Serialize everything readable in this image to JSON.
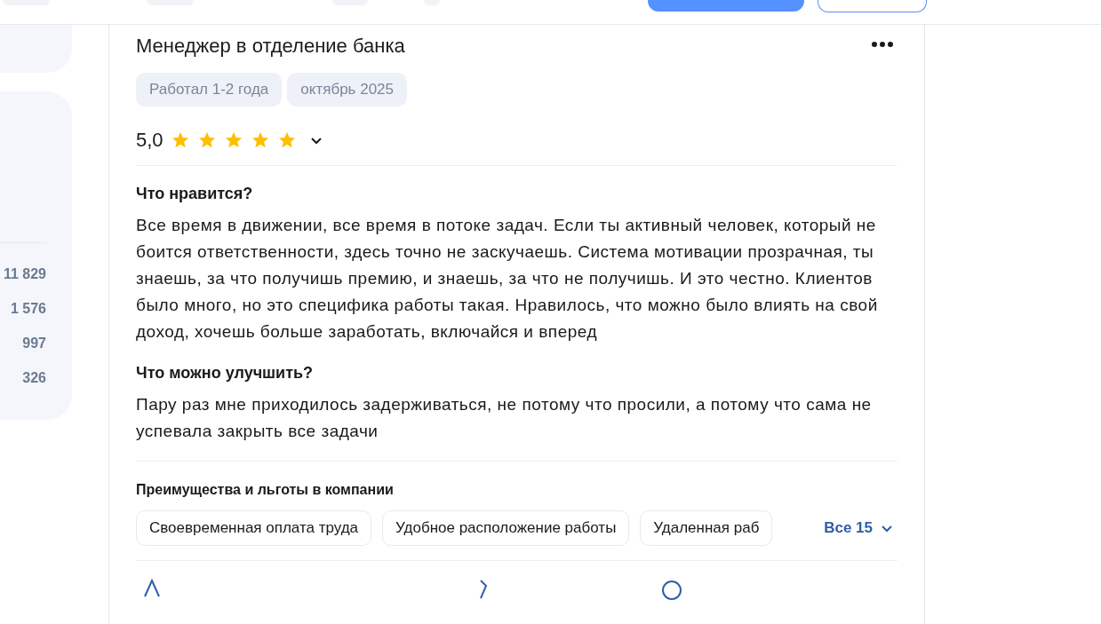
{
  "sidebar": {
    "counts": [
      "11 829",
      "1 576",
      "997",
      "326"
    ]
  },
  "review": {
    "title": "Менеджер в отделение банка",
    "tags": [
      "Работал 1-2 года",
      "октябрь 2025"
    ],
    "rating": "5,0",
    "stars": 5,
    "expanded": false,
    "sections": [
      {
        "heading": "Что нравится?",
        "text": "Все время в движении, все время в потоке задач. Если ты активный человек, который не боится ответственности, здесь точно не заскучаешь. Система мотивации прозрачная, ты знаешь, за что получишь премию, и знаешь, за что не получишь. И это честно. Клиентов было много, но это специфика работы такая. Нравилось, что можно было влиять на свой доход, хочешь больше заработать, включайся и вперед"
      },
      {
        "heading": "Что можно улучшить?",
        "text": "Пару раз мне приходилось задерживаться, не потому что просили, а потому что сама не успевала закрыть все задачи"
      }
    ],
    "benefits": {
      "heading": "Преимущества и льготы в компании",
      "items": [
        "Своевременная оплата труда",
        "Удобное расположение работы",
        "Удаленная раб"
      ],
      "more": "Все 15"
    }
  }
}
